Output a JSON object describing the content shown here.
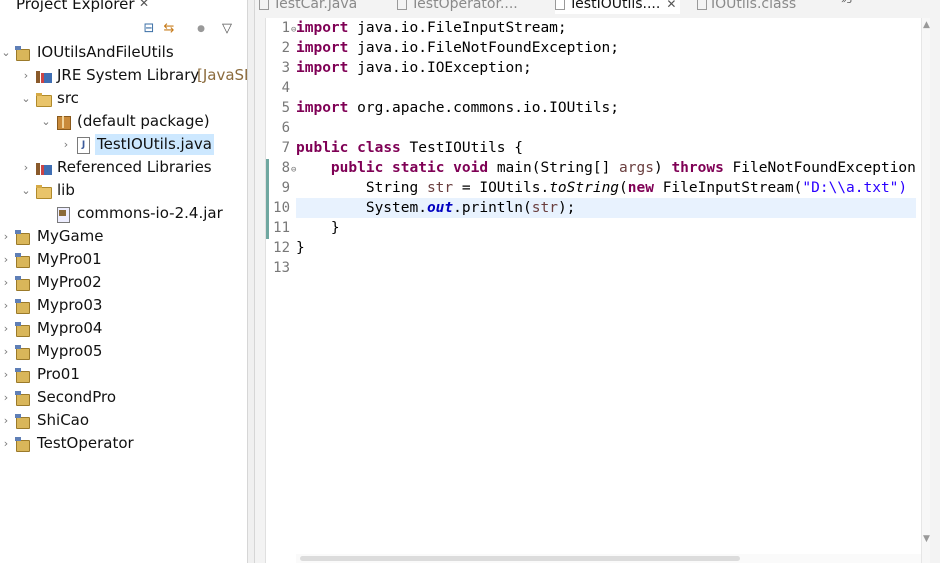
{
  "explorer": {
    "title": "Project Explorer",
    "close_glyph": "✕",
    "toolbar": {
      "collapse_all": "⊟",
      "link_with_editor": "⇆",
      "focus": "●",
      "view_menu": "▽"
    },
    "tree": [
      {
        "label": "IOUtilsAndFileUtils",
        "expanded": true,
        "indent": 0,
        "icon": "project-icon"
      },
      {
        "label": "JRE System Library",
        "decoration": "[JavaSE",
        "expanded": false,
        "indent": 1,
        "icon": "library-icon"
      },
      {
        "label": "src",
        "expanded": true,
        "indent": 1,
        "icon": "source-folder-icon"
      },
      {
        "label": "(default package)",
        "expanded": true,
        "indent": 2,
        "icon": "package-icon"
      },
      {
        "label": "TestIOUtils.java",
        "expanded": false,
        "indent": 3,
        "icon": "java-file-icon",
        "selected": true
      },
      {
        "label": "Referenced Libraries",
        "expanded": false,
        "indent": 1,
        "icon": "library-icon"
      },
      {
        "label": "lib",
        "expanded": true,
        "indent": 1,
        "icon": "folder-icon"
      },
      {
        "label": "commons-io-2.4.jar",
        "indent": 2,
        "icon": "jar-icon"
      },
      {
        "label": "MyGame",
        "expanded": false,
        "indent": 0,
        "icon": "project-icon"
      },
      {
        "label": "MyPro01",
        "expanded": false,
        "indent": 0,
        "icon": "project-icon"
      },
      {
        "label": "MyPro02",
        "expanded": false,
        "indent": 0,
        "icon": "project-icon"
      },
      {
        "label": "Mypro03",
        "expanded": false,
        "indent": 0,
        "icon": "project-icon"
      },
      {
        "label": "Mypro04",
        "expanded": false,
        "indent": 0,
        "icon": "project-icon"
      },
      {
        "label": "Mypro05",
        "expanded": false,
        "indent": 0,
        "icon": "project-icon"
      },
      {
        "label": "Pro01",
        "expanded": false,
        "indent": 0,
        "icon": "project-icon"
      },
      {
        "label": "SecondPro",
        "expanded": false,
        "indent": 0,
        "icon": "project-icon"
      },
      {
        "label": "ShiCao",
        "expanded": false,
        "indent": 0,
        "icon": "project-icon"
      },
      {
        "label": "TestOperator",
        "expanded": false,
        "indent": 0,
        "icon": "project-icon"
      }
    ]
  },
  "tabs": [
    {
      "label": "TestCar.java",
      "active": false
    },
    {
      "label": "TestOperator....",
      "active": false
    },
    {
      "label": "TestIOUtils....",
      "active": true,
      "close": "✕"
    },
    {
      "label": "IOUtils.class",
      "active": false
    }
  ],
  "tab_overflow": "»5",
  "editor": {
    "line_numbers": [
      "1",
      "2",
      "3",
      "4",
      "5",
      "6",
      "7",
      "8",
      "9",
      "10",
      "11",
      "12",
      "13"
    ],
    "folds": {
      "1": "⊖",
      "8": "⊖"
    },
    "current_line": 10,
    "lines": [
      [
        {
          "t": "import",
          "c": "kw"
        },
        {
          "t": " java.io.FileInputStream;"
        }
      ],
      [
        {
          "t": "import",
          "c": "kw"
        },
        {
          "t": " java.io.FileNotFoundException;"
        }
      ],
      [
        {
          "t": "import",
          "c": "kw"
        },
        {
          "t": " java.io.IOException;"
        }
      ],
      [],
      [
        {
          "t": "import",
          "c": "kw"
        },
        {
          "t": " org.apache.commons.io.IOUtils;"
        }
      ],
      [],
      [
        {
          "t": "public",
          "c": "kw"
        },
        {
          "t": " "
        },
        {
          "t": "class",
          "c": "kw"
        },
        {
          "t": " TestIOUtils {"
        }
      ],
      [
        {
          "t": "    "
        },
        {
          "t": "public",
          "c": "kw"
        },
        {
          "t": " "
        },
        {
          "t": "static",
          "c": "kw"
        },
        {
          "t": " "
        },
        {
          "t": "void",
          "c": "kw"
        },
        {
          "t": " main(String[] "
        },
        {
          "t": "args",
          "c": "prm"
        },
        {
          "t": ") "
        },
        {
          "t": "throws",
          "c": "kw"
        },
        {
          "t": " FileNotFoundException"
        }
      ],
      [
        {
          "t": "        String "
        },
        {
          "t": "str",
          "c": "prm"
        },
        {
          "t": " = IOUtils."
        },
        {
          "t": "toString",
          "c": "it"
        },
        {
          "t": "("
        },
        {
          "t": "new",
          "c": "kw"
        },
        {
          "t": " FileInputStream("
        },
        {
          "t": "\"D:\\\\a.txt\")",
          "c": "str"
        }
      ],
      [
        {
          "t": "        System."
        },
        {
          "t": "out",
          "c": "fld"
        },
        {
          "t": ".println("
        },
        {
          "t": "str",
          "c": "prm"
        },
        {
          "t": ");"
        }
      ],
      [
        {
          "t": "    }"
        }
      ],
      [
        {
          "t": "}"
        }
      ],
      []
    ]
  },
  "scroll": {
    "up": "▲",
    "down": "▼"
  }
}
